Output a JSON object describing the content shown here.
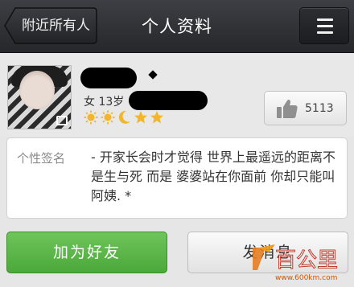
{
  "header": {
    "back_label": "附近所有人",
    "title": "个人资料"
  },
  "profile": {
    "gender_age": "女 13岁",
    "level_icons": [
      "sun",
      "sun",
      "moon",
      "star",
      "star"
    ],
    "likes": "5113"
  },
  "signature": {
    "label": "个性签名",
    "text": "- 开家长会时才觉得 世界上最遥远的距离不是生与死 而是 婆婆站在你面前 你却只能叫阿姨. *"
  },
  "actions": {
    "add_friend": "加为好友",
    "send_message": "发消息"
  },
  "colors": {
    "header_bg": "#2b2d31",
    "add_button": "#5bb646",
    "level_gold": "#f3b52a"
  },
  "watermark": {
    "text": "百公里",
    "url": "www.600km.com"
  }
}
